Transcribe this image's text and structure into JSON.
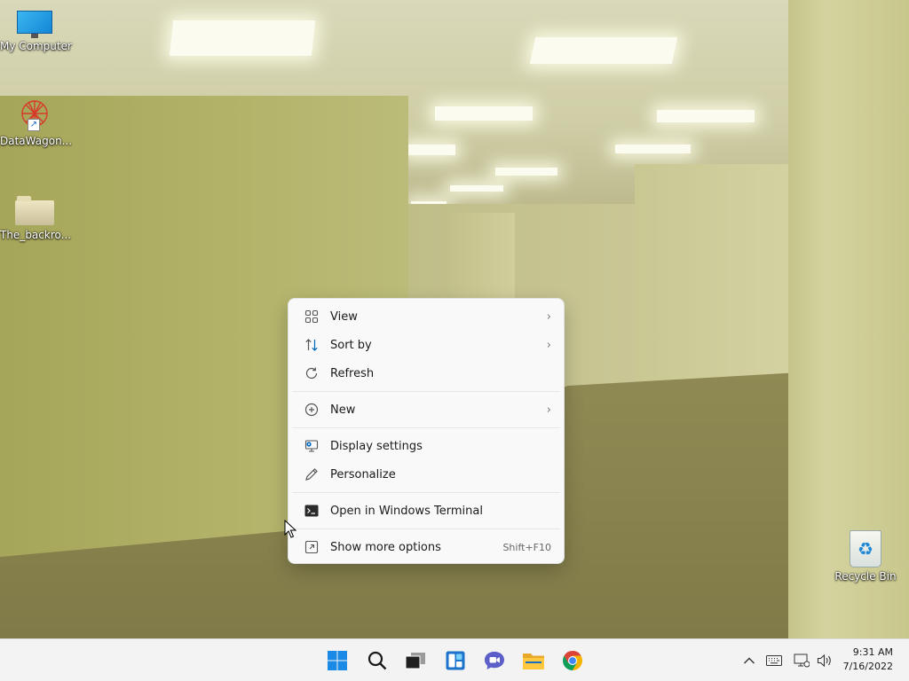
{
  "desktop_icons": {
    "my_computer": "My Computer",
    "datawagon": "DataWagon...",
    "backrooms": "The_backro...",
    "recycle_bin": "Recycle Bin"
  },
  "context_menu": {
    "items": [
      {
        "label": "View",
        "icon": "grid-icon",
        "submenu": true
      },
      {
        "label": "Sort by",
        "icon": "sort-icon",
        "submenu": true
      },
      {
        "label": "Refresh",
        "icon": "refresh-icon",
        "submenu": false
      },
      {
        "label": "New",
        "icon": "plus-circle-icon",
        "submenu": true
      },
      {
        "label": "Display settings",
        "icon": "display-settings-icon",
        "submenu": false
      },
      {
        "label": "Personalize",
        "icon": "pen-icon",
        "submenu": false
      },
      {
        "label": "Open in Windows Terminal",
        "icon": "terminal-icon",
        "submenu": false
      },
      {
        "label": "Show more options",
        "icon": "more-options-icon",
        "submenu": false,
        "shortcut": "Shift+F10"
      }
    ]
  },
  "taskbar": {
    "apps": [
      "start-icon",
      "search-icon",
      "task-view-icon",
      "widgets-icon",
      "chat-icon",
      "file-explorer-icon",
      "chrome-icon"
    ],
    "tray": [
      "chevron-up-icon",
      "keyboard-icon",
      "network-icon",
      "volume-icon"
    ],
    "clock": {
      "time": "9:31 AM",
      "date": "7/16/2022"
    }
  },
  "colors": {
    "taskbar_bg": "#f3f3f3",
    "menu_bg": "#f9f9f9",
    "accent": "#0067c0"
  }
}
